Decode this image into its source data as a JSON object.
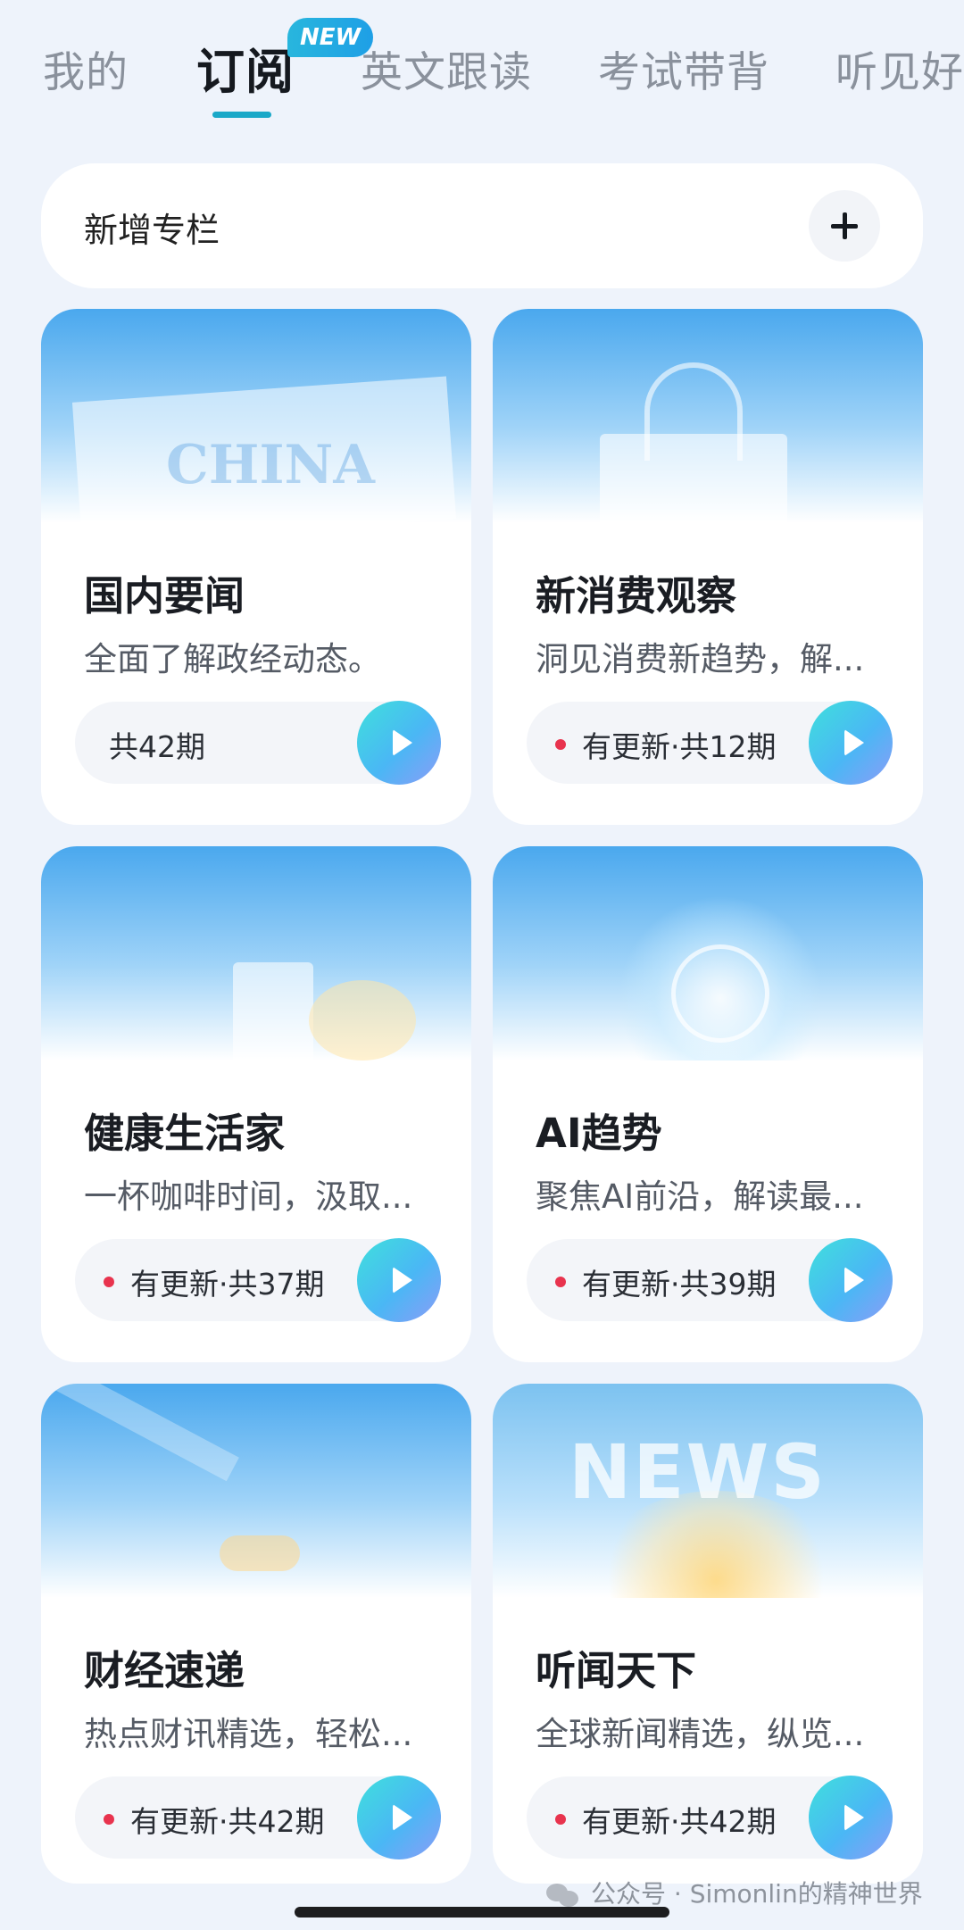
{
  "tabs": [
    {
      "label": "我的"
    },
    {
      "label": "订阅",
      "active": true,
      "badge": "NEW"
    },
    {
      "label": "英文跟读"
    },
    {
      "label": "考试带背"
    },
    {
      "label": "听见好书"
    }
  ],
  "add_column": {
    "label": "新增专栏"
  },
  "cards": [
    {
      "title": "国内要闻",
      "desc": "全面了解政经动态。",
      "status": "共42期",
      "has_update": false,
      "art_text": "CHINA"
    },
    {
      "title": "新消费观察",
      "desc": "洞见消费新趋势，解...",
      "status": "有更新·共12期",
      "has_update": true
    },
    {
      "title": "健康生活家",
      "desc": "一杯咖啡时间，汲取...",
      "status": "有更新·共37期",
      "has_update": true
    },
    {
      "title": "AI趋势",
      "desc": "聚焦AI前沿，解读最...",
      "status": "有更新·共39期",
      "has_update": true
    },
    {
      "title": "财经速递",
      "desc": "热点财讯精选，轻松...",
      "status": "有更新·共42期",
      "has_update": true
    },
    {
      "title": "听闻天下",
      "desc": "全球新闻精选，纵览...",
      "status": "有更新·共42期",
      "has_update": true,
      "art_text": "NEWS"
    }
  ],
  "watermark": "公众号 · Simonlin的精神世界",
  "colors": {
    "accent": "#1aa8c8",
    "update_dot": "#e8334e"
  }
}
